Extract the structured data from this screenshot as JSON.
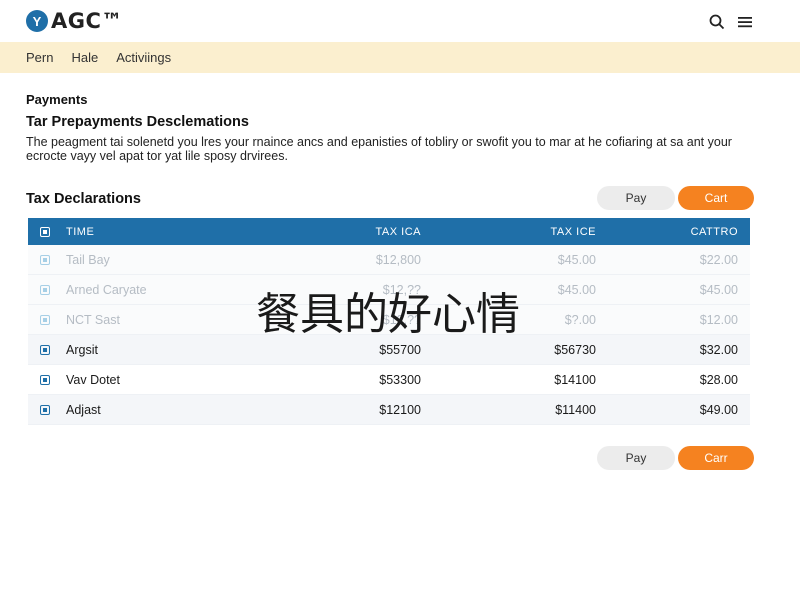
{
  "app": {
    "logo_mark": "Y",
    "logo_text": "AGC™"
  },
  "topbar": {
    "icons": [
      "search-icon",
      "menu-icon"
    ]
  },
  "nav": {
    "items": [
      "Pern",
      "Hale",
      "Activiings"
    ]
  },
  "intro": {
    "label": "Payments",
    "title": "Tar Prepayments Desclemations",
    "description": "The peagment tai solenetd you lres your rnaince ancs and epanisties of tobliry or swofit you to mar at he cofiaring at sa ant your ecrocte vayy vel apat tor yat lile sposy drvirees."
  },
  "table_section": {
    "title": "Tax Declarations",
    "pay_label": "Pay",
    "cart_label": "Cart"
  },
  "table": {
    "columns": [
      "TIME",
      "TAX ICA",
      "TAX ICE",
      "CATTRO"
    ],
    "rows": [
      {
        "name": "Tail Bay",
        "a": "$12,800",
        "b": "$45.00",
        "c": "$22.00",
        "state": "faded"
      },
      {
        "name": "Arned Caryate",
        "a": "$12,??",
        "b": "$45.00",
        "c": "$45.00",
        "state": "faded"
      },
      {
        "name": "NCT Sast",
        "a": "$12,??",
        "b": "$?.00",
        "c": "$12.00",
        "state": "faded"
      },
      {
        "name": "Argsit",
        "a": "$55700",
        "b": "$56730",
        "c": "$32.00",
        "state": "dark"
      },
      {
        "name": "Vav Dotet",
        "a": "$53300",
        "b": "$14100",
        "c": "$28.00",
        "state": "dark"
      },
      {
        "name": "Adjast",
        "a": "$12100",
        "b": "$11400",
        "c": "$49.00",
        "state": "dark"
      }
    ]
  },
  "footer_actions": {
    "pay_label": "Pay",
    "cart_label": "Carr"
  },
  "overlay_text": "餐具的好心情",
  "colors": {
    "accent": "#1f6fa8",
    "cart": "#f58220",
    "navbar": "#fbefcf"
  }
}
